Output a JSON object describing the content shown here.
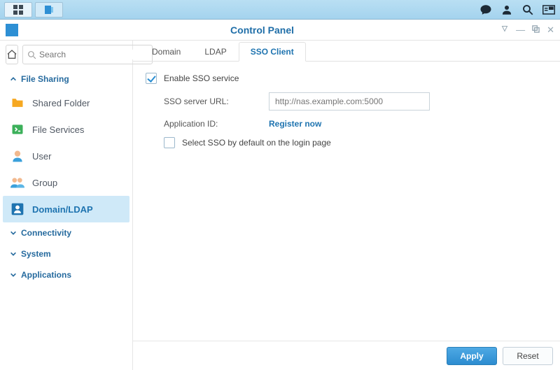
{
  "window": {
    "title": "Control Panel"
  },
  "search": {
    "placeholder": "Search"
  },
  "sidebar": {
    "sections": {
      "file_sharing": "File Sharing",
      "connectivity": "Connectivity",
      "system": "System",
      "applications": "Applications"
    },
    "items": {
      "shared_folder": "Shared Folder",
      "file_services": "File Services",
      "user": "User",
      "group": "Group",
      "domain_ldap": "Domain/LDAP"
    }
  },
  "tabs": {
    "domain": "Domain",
    "ldap": "LDAP",
    "sso": "SSO Client"
  },
  "sso": {
    "enable_label": "Enable SSO service",
    "server_label": "SSO server URL:",
    "server_placeholder": "http://nas.example.com:5000",
    "appid_label": "Application ID:",
    "register_link": "Register now",
    "default_label": "Select SSO by default on the login page"
  },
  "footer": {
    "apply": "Apply",
    "reset": "Reset"
  }
}
